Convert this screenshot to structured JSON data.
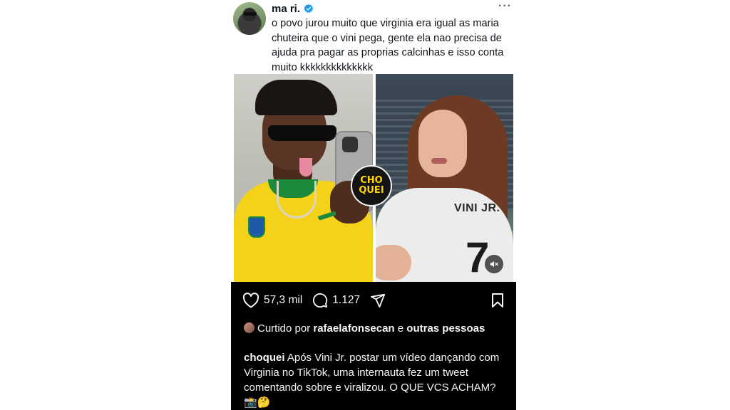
{
  "tweet": {
    "author_name": "ma ri.",
    "verified_icon": "verified-badge-icon",
    "more_label": "···",
    "text": "o povo jurou muito que virginia era igual as maria chuteira que o vini pega, gente ela nao precisa de ajuda pra pagar as proprias calcinhas e isso conta muito kkkkkkkkkkkkkk"
  },
  "photos": {
    "badge_line1": "CHO",
    "badge_line2": "QUEI",
    "jersey_text": "VINI JR.",
    "jersey_number": "7"
  },
  "instagram": {
    "likes": "57,3 mil",
    "comments": "1.127",
    "liked_prefix": "Curtido por",
    "liked_user": "rafaelafonsecan",
    "liked_conj": "e",
    "liked_suffix": "outras pessoas",
    "caption_user": "choquei",
    "caption_text": "Após Vini Jr. postar um vídeo dançando com Virginia no TikTok, uma internauta fez um tweet comentando sobre e viralizou. O QUE VCS ACHAM? 📸🤔"
  },
  "colors": {
    "verified": "#1d9bf0",
    "badge_yellow": "#ffd500",
    "ig_bg": "#000000"
  }
}
